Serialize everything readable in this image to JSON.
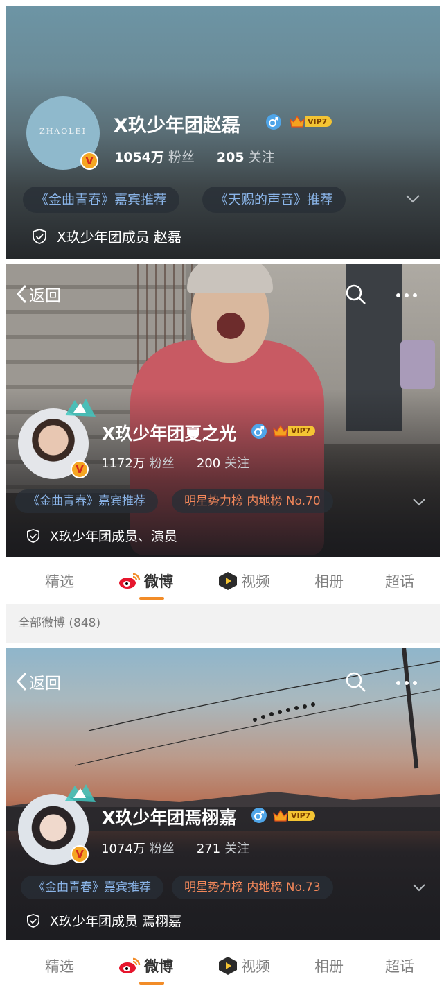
{
  "profile1": {
    "avatar_text": "ZHAOLEI",
    "name": "X玖少年团赵磊",
    "vip": "VIP7",
    "fans": "1054万",
    "fans_label": "粉丝",
    "follow": "205",
    "follow_label": "关注",
    "tags": [
      "《金曲青春》嘉宾推荐",
      "《天赐的声音》推荐"
    ],
    "verify": "X玖少年团成员 赵磊"
  },
  "profile2": {
    "back_label": "返回",
    "name": "X玖少年团夏之光",
    "vip": "VIP7",
    "fans": "1172万",
    "fans_label": "粉丝",
    "follow": "200",
    "follow_label": "关注",
    "tags": [
      "《金曲青春》嘉宾推荐",
      "明星势力榜 内地榜 No.70"
    ],
    "verify": "X玖少年团成员、演员",
    "tabs": [
      "精选",
      "微博",
      "视频",
      "相册",
      "超话"
    ],
    "active_tab": "微博",
    "weibo_count": "全部微博 (848)"
  },
  "profile3": {
    "back_label": "返回",
    "name": "X玖少年团焉栩嘉",
    "vip": "VIP7",
    "fans": "1074万",
    "fans_label": "粉丝",
    "follow": "271",
    "follow_label": "关注",
    "tags": [
      "《金曲青春》嘉宾推荐",
      "明星势力榜 内地榜 No.73"
    ],
    "verify": "X玖少年团成员 焉栩嘉",
    "tabs": [
      "精选",
      "微博",
      "视频",
      "相册",
      "超话"
    ],
    "active_tab": "微博"
  },
  "badge_letter": "V",
  "icons": [
    "back-arrow-icon",
    "search-icon",
    "more-icon",
    "male-icon",
    "vip-crown-icon",
    "verified-badge-icon",
    "shield-check-icon",
    "chevron-down-icon",
    "weibo-logo-icon",
    "video-play-icon"
  ],
  "colors": {
    "accent": "#f28c28",
    "tag_blue": "#8ab4e8",
    "tag_orange": "#f2875a",
    "gender_blue": "#4fa5e8",
    "vip_gold": "#f4c433"
  }
}
